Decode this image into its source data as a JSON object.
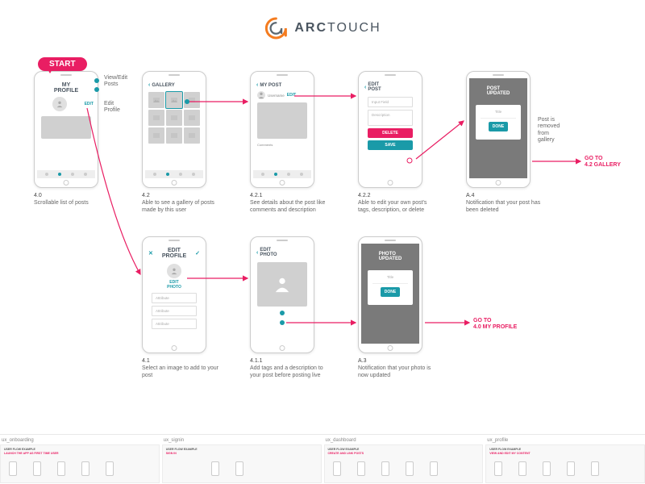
{
  "logo": {
    "bold": "ARC",
    "light": "TOUCH"
  },
  "start": "START",
  "annotations": {
    "view_edit_posts": "View/Edit\nPosts",
    "edit_profile": "Edit\nProfile",
    "post_removed": "Post is\nremoved\nfrom\ngallery",
    "goto_gallery": "GO TO\n4.2 GALLERY",
    "goto_profile": "GO TO\n4.0 MY PROFILE"
  },
  "screens": {
    "s40": {
      "title": "MY\nPROFILE",
      "edit": "EDIT",
      "cap_num": "4.0",
      "cap_text": "Scrollable list of posts"
    },
    "s42": {
      "title": "GALLERY",
      "cap_num": "4.2",
      "cap_text": "Able to see a gallery of posts made by this user"
    },
    "s421": {
      "title": "MY POST",
      "user": "Username",
      "edit": "EDIT",
      "comments": "Comments",
      "cap_num": "4.2.1",
      "cap_text": "See details about the post like comments and description"
    },
    "s422": {
      "title": "EDIT\nPOST",
      "input": "Input Field",
      "desc": "Description",
      "delete": "DELETE",
      "save": "SAVE",
      "cap_num": "4.2.2",
      "cap_text": "Able to edit your own post's tags, description, or delete"
    },
    "sA4": {
      "title": "POST\nUPDATED",
      "modal_title": "Title",
      "done": "DONE",
      "cap_num": "A.4",
      "cap_text": "Notification that your post has been deleted"
    },
    "s41": {
      "title": "EDIT\nPROFILE",
      "edit_photo": "EDIT\nPHOTO",
      "attr": "Attribute",
      "cap_num": "4.1",
      "cap_text": "Select an image to add to your post"
    },
    "s411": {
      "title": "EDIT\nPHOTO",
      "cap_num": "4.1.1",
      "cap_text": "Add tags and a description to your post before posting live"
    },
    "sA3": {
      "title": "PHOTO\nUPDATED",
      "modal_title": "Title",
      "done": "DONE",
      "cap_num": "A.3",
      "cap_text": "Notification that your photo is now updated"
    }
  },
  "docs": {
    "d1": {
      "label": "ux_onboarding",
      "title": "USER FLOW EXAMPLE",
      "sub": "LAUNCH THE APP AS FIRST TIME USER"
    },
    "d2": {
      "label": "ux_signin",
      "title": "USER FLOW EXAMPLE",
      "sub": "SIGN IN"
    },
    "d3": {
      "label": "ux_dashboard",
      "title": "USER FLOW EXAMPLE",
      "sub": "CREATE AND LINK POSTS"
    },
    "d4": {
      "label": "ux_profile",
      "title": "USER FLOW EXAMPLE",
      "sub": "VIEW AND EDIT MY CONTENT"
    }
  }
}
